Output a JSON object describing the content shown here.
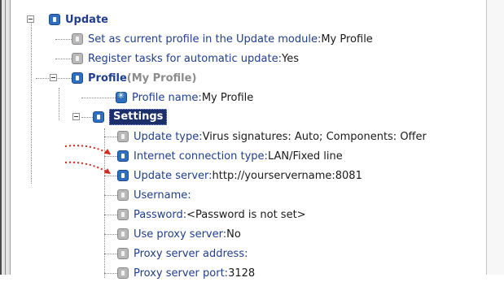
{
  "tree": {
    "update": {
      "label": "Update",
      "children": {
        "set_current_profile": {
          "key": "Set as current profile in the Update module:",
          "value": " My Profile"
        },
        "register_tasks": {
          "key": "Register tasks for automatic update:",
          "value": " Yes"
        }
      }
    },
    "profile": {
      "label": "Profile",
      "suffix": " (My Profile)",
      "profile_name": {
        "key": "Profile name:",
        "value": " My Profile"
      }
    },
    "settings": {
      "label": "Settings",
      "items": [
        {
          "key": "Update type:",
          "value": " Virus signatures: Auto; Components: Offer"
        },
        {
          "key": "Internet connection type:",
          "value": " LAN/Fixed line"
        },
        {
          "key": "Update server:",
          "value": " http://yourservername:8081"
        },
        {
          "key": "Username:",
          "value": ""
        },
        {
          "key": "Password:",
          "value": " <Password is not set>"
        },
        {
          "key": "Use proxy server:",
          "value": " No"
        },
        {
          "key": "Proxy server address:",
          "value": ""
        },
        {
          "key": "Proxy server port:",
          "value": " 3128"
        }
      ]
    }
  },
  "icons": {
    "setting_active": "blue-square-icon",
    "setting_inactive": "grey-square-icon",
    "profile_name": "asterisk-icon"
  },
  "colors": {
    "selection": "#1c2f6b",
    "key_text": "#1f3e8f",
    "icon_blue": "#2f6fbd",
    "icon_grey": "#b9b9b9",
    "annotation_arrow": "#d9261c"
  }
}
